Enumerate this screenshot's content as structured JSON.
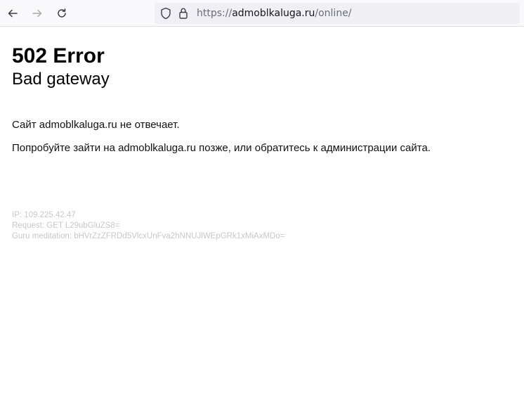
{
  "browser": {
    "url_scheme": "https://",
    "url_host": "admoblkaluga.ru",
    "url_path": "/online/"
  },
  "error": {
    "title": "502 Error",
    "subtitle": "Bad gateway",
    "message_1": "Сайт admoblkaluga.ru не отвечает.",
    "message_2": "Попробуйте зайти на admoblkaluga.ru позже, или обратитесь к администрации сайта."
  },
  "diagnostics": {
    "ip": "IP: 109.225.42.47",
    "request": "Request: GET L29ubGluZS8=",
    "guru": "Guru meditation: bHVrZzZFRDd5VlcxUnFva2hNNUJlWEpGRk1xMiAxMDo="
  }
}
